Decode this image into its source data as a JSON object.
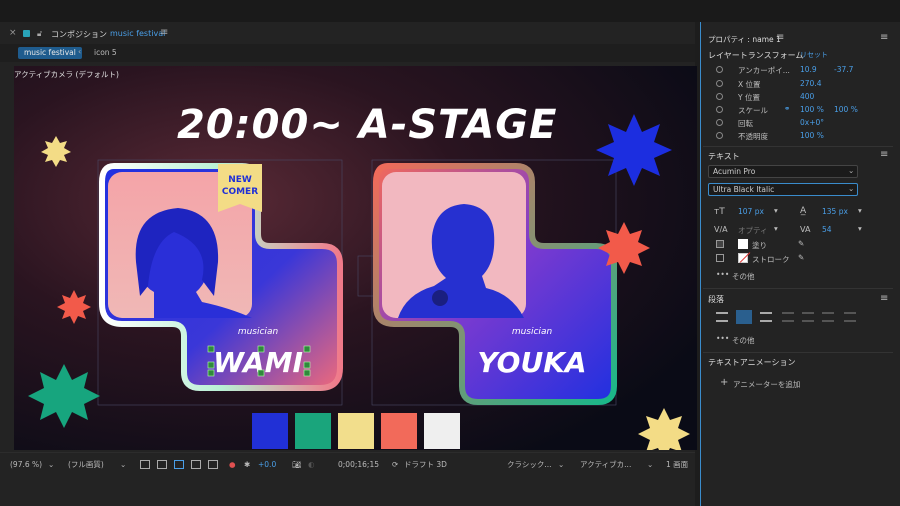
{
  "comp": {
    "close": "×",
    "title": "コンポジション",
    "comp_name": "music festival",
    "menu_icon": "≡",
    "tabs": [
      "music festival",
      "icon 5"
    ],
    "camera_label": "アクティブカメラ (デフォルト)"
  },
  "canvas": {
    "headline": "20:00~ A-STAGE",
    "cards": [
      {
        "role": "musician",
        "name": "WAMI",
        "badge": [
          "NEW",
          "COMER"
        ]
      },
      {
        "role": "musician",
        "name": "YOUKA"
      }
    ],
    "swatches": [
      "#2130d6",
      "#1aa57c",
      "#f2de8c",
      "#f26a5a",
      "#efefef"
    ],
    "colors": {
      "blue": "#1c2ee0",
      "red": "#f25a4a",
      "yellow": "#f3dc86",
      "green": "#17a57e",
      "headline": "#ffffff"
    }
  },
  "viewer_bar": {
    "zoom": "(97.6 %)",
    "quality": "(フル画質)",
    "exposure": "+0.0",
    "timecode": "0;00;16;15",
    "draft": "ドラフト 3D",
    "renderer": "クラシック...",
    "camera": "アクティブカ...",
    "views": "1 画面"
  },
  "props": {
    "title": "プロパティ : name 1",
    "transform_label": "レイヤートランスフォーム",
    "reset": "リセット",
    "rows": [
      {
        "label": "アンカーポイ...",
        "v1": "10.9",
        "v2": "-37.7"
      },
      {
        "label": "X 位置",
        "v1": "270.4",
        "v2": ""
      },
      {
        "label": "Y 位置",
        "v1": "400",
        "v2": ""
      },
      {
        "label": "スケール",
        "v1": "100 %",
        "v2": "100 %"
      },
      {
        "label": "回転",
        "v1": "0x+0°",
        "v2": ""
      },
      {
        "label": "不透明度",
        "v1": "100 %",
        "v2": ""
      }
    ],
    "text_label": "テキスト",
    "font": "Acumin Pro",
    "style": "Ultra Black Italic",
    "size": "107 px",
    "leading": "135 px",
    "kerning": "オプティ",
    "tracking": "54",
    "fill_label": "塗り",
    "stroke_label": "ストローク",
    "more": "その他",
    "paragraph_label": "段落",
    "more2": "その他",
    "anim_label": "テキストアニメーション",
    "add_animator": "アニメーターを追加"
  }
}
